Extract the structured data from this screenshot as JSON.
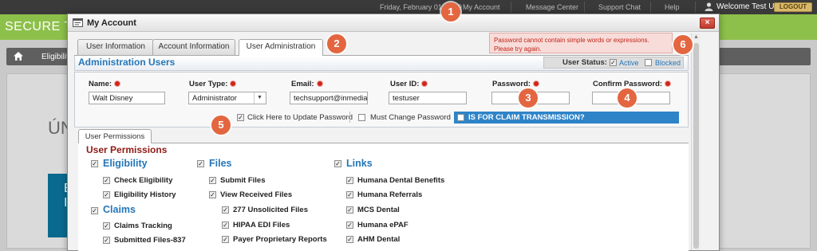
{
  "topbar": {
    "date": "Friday, February 01, 2019",
    "my_account": "My Account",
    "message_center": "Message Center",
    "support_chat": "Support Chat",
    "help": "Help",
    "welcome": "Welcome Test User",
    "logout": "LOGOUT"
  },
  "background": {
    "logo": "SECURE T",
    "nav_item": "Eligibility",
    "panel_text": "ÚN",
    "panel_blue_text": [
      "E",
      "I"
    ]
  },
  "dialog": {
    "title": "My Account",
    "close": "×",
    "tabs": [
      "User Information",
      "Account Information",
      "User Administration"
    ],
    "active_tab": "User Administration",
    "error_message": "Password cannot contain simple words or expressions. Please try again."
  },
  "admin": {
    "title": "Administration Users",
    "status_label": "User Status:",
    "status_active_label": "Active",
    "status_active_checked": true,
    "status_blocked_label": "Blocked",
    "status_blocked_checked": false
  },
  "form": {
    "name_label": "Name:",
    "name_value": "Walt Disney",
    "user_type_label": "User Type:",
    "user_type_value": "Administrator",
    "email_label": "Email:",
    "email_value": "techsupport@inmedia",
    "user_id_label": "User ID:",
    "user_id_value": "testuser",
    "password_label": "Password:",
    "password_value": "",
    "confirm_label": "Confirm Password:",
    "confirm_value": "",
    "update_password_label": "Click Here to Update Password",
    "update_password_checked": true,
    "must_change_label": "Must Change Password",
    "must_change_checked": false,
    "claim_label": "IS FOR CLAIM TRANSMISSION?",
    "claim_checked": false
  },
  "permissions": {
    "tab_label": "User Permissions",
    "title": "User Permissions",
    "groups": [
      {
        "label": "Eligibility",
        "items": [
          "Check Eligibility",
          "Eligibility History"
        ]
      },
      {
        "label": "Claims",
        "items": [
          "Claims Tracking",
          "Submitted Files-837"
        ]
      },
      {
        "label": "Files",
        "items": [
          "Submit Files",
          "View Received Files"
        ],
        "sub_items": [
          "277 Unsolicited Files",
          "HIPAA EDI Files",
          "Payer Proprietary Reports"
        ]
      },
      {
        "label": "Links",
        "items": [
          "Humana Dental Benefits",
          "Humana Referrals",
          "MCS Dental",
          "Humana ePAF",
          "AHM Dental"
        ]
      }
    ]
  },
  "badges": [
    "1",
    "2",
    "3",
    "4",
    "5",
    "6"
  ],
  "colors": {
    "accent_blue": "#2476b8",
    "error_red": "#c0241a",
    "permission_title": "#8e1a14",
    "badge": "#e36640",
    "brand_green": "#8dc04a"
  },
  "icons": {
    "user": "user-icon",
    "home": "home-icon",
    "dialog": "window-icon",
    "close": "close-icon",
    "required": "required-dot-icon",
    "dropdown": "chevron-down-icon"
  }
}
